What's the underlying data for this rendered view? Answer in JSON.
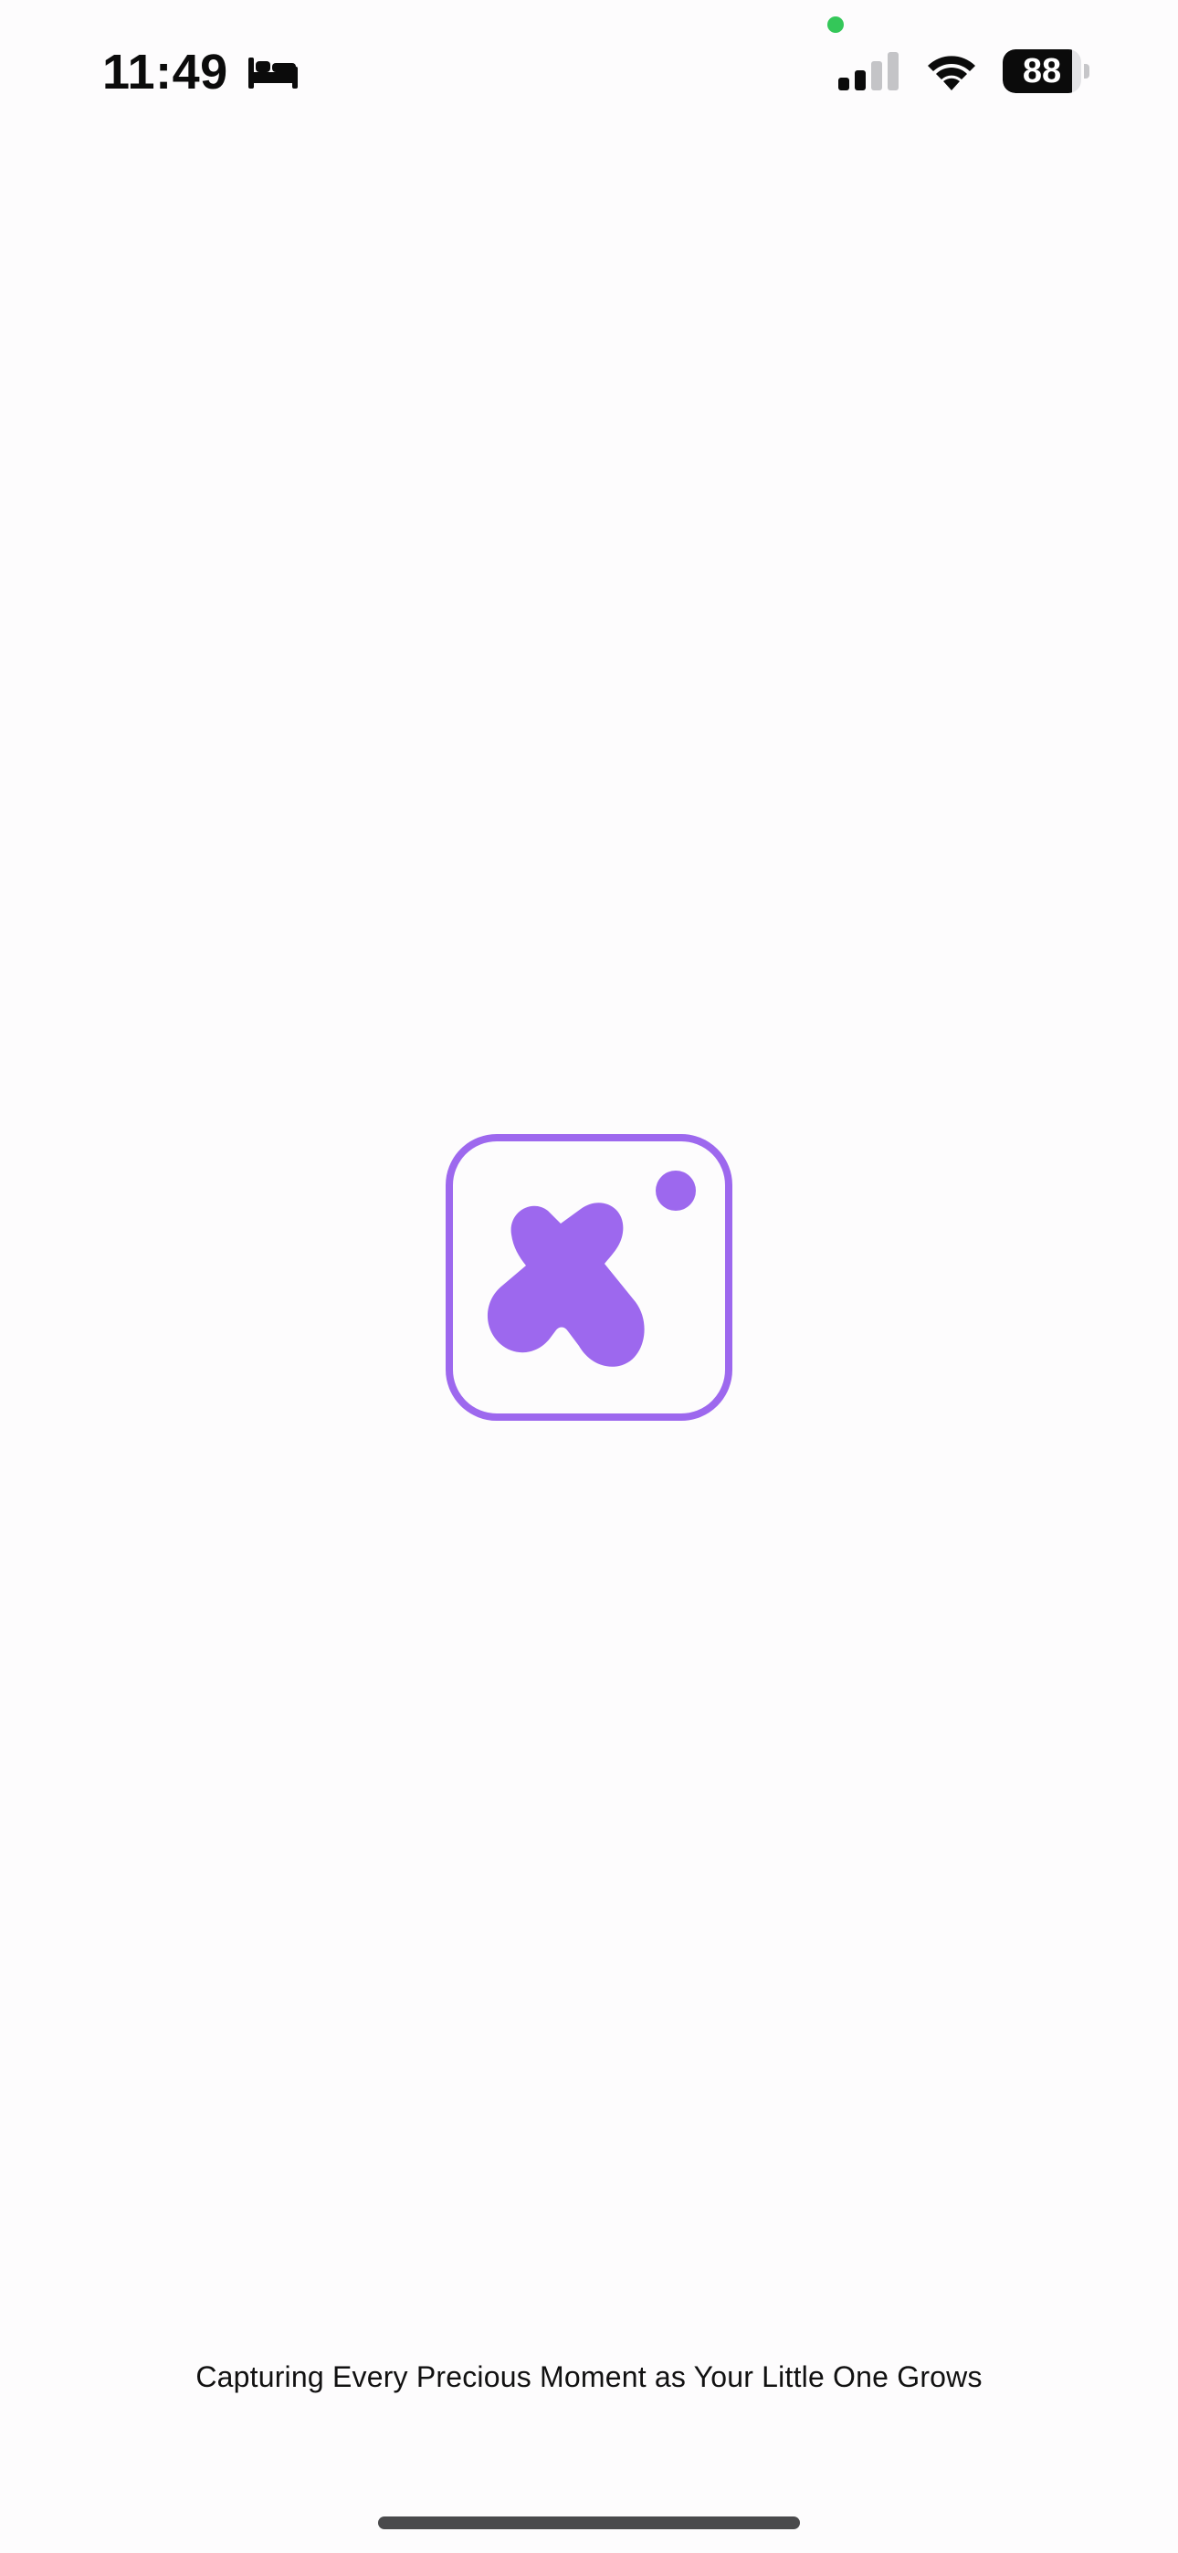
{
  "status_bar": {
    "time": "11:49",
    "focus_mode_icon": "bed-icon",
    "signal_icon": "cellular-signal-icon",
    "wifi_icon": "wifi-icon",
    "battery_percent": 88,
    "battery_label": "88",
    "mic_indicator_color": "#34c759"
  },
  "splash": {
    "logo_icon": "app-logo-icon",
    "brand_color": "#9d68ee",
    "tagline": "Capturing Every Precious Moment as Your Little One Grows"
  },
  "home_indicator": {
    "icon": "home-indicator"
  }
}
